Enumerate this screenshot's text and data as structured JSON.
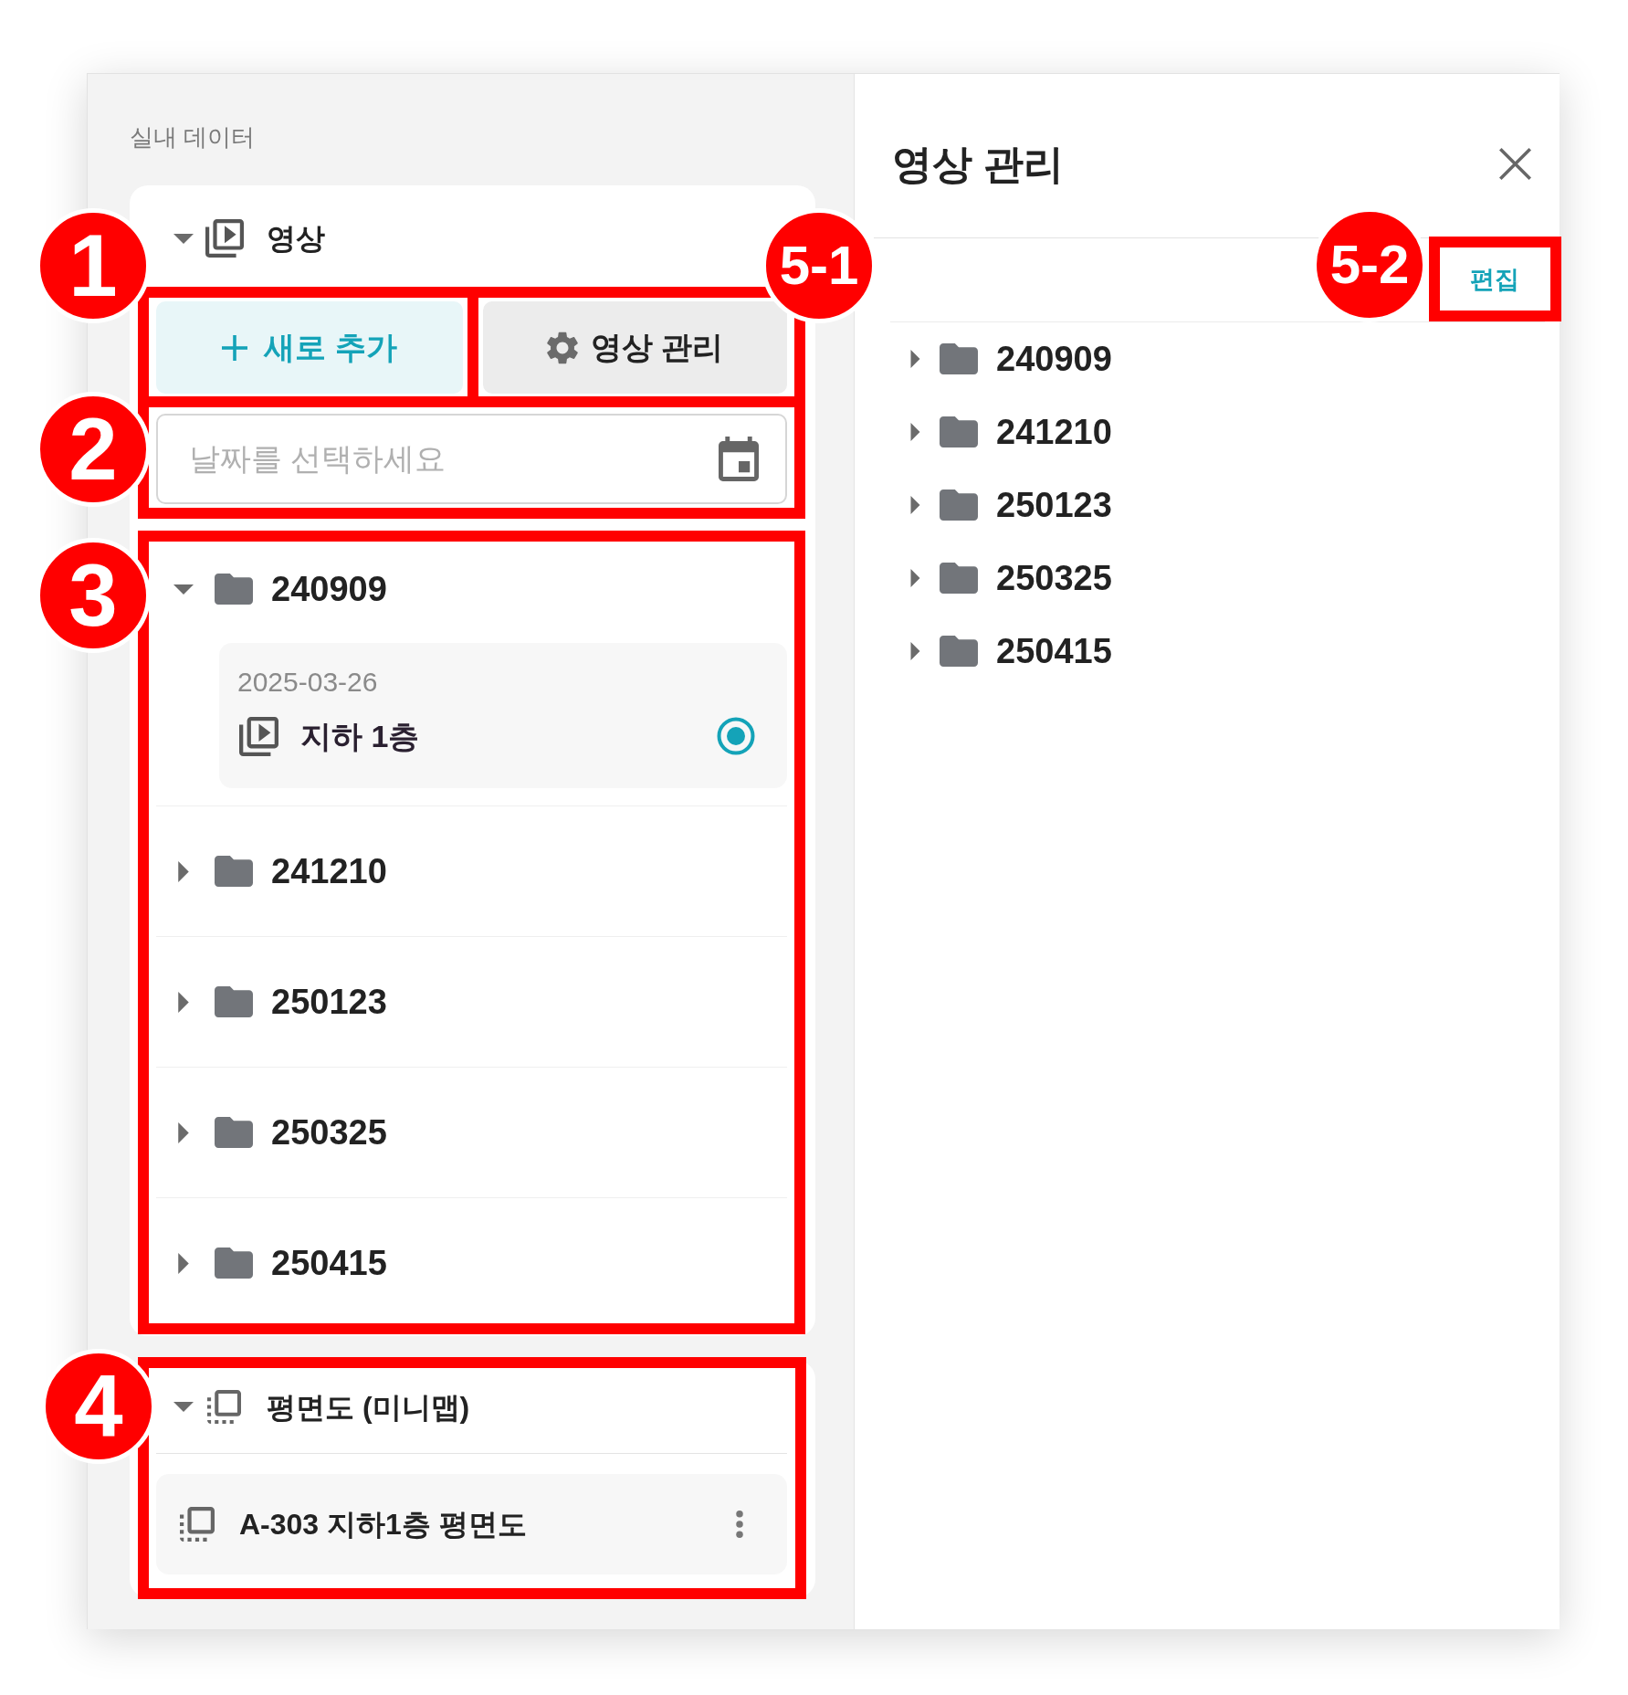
{
  "left_panel": {
    "heading": "실내 데이터",
    "video_section": {
      "title": "영상",
      "expanded": true,
      "buttons": [
        {
          "kind": "add",
          "label": "새로 추가",
          "callout": "1"
        },
        {
          "kind": "manage",
          "label": "영상 관리",
          "callout": "5-1"
        }
      ],
      "date_field": {
        "placeholder": "날짜를 선택하세요",
        "callout": "2"
      },
      "folder_list": {
        "callout": "3",
        "folders": [
          {
            "name": "240909",
            "expanded": true,
            "children": [
              {
                "date": "2025-03-26",
                "name": "지하 1층",
                "selected": true
              }
            ]
          },
          {
            "name": "241210",
            "expanded": false
          },
          {
            "name": "250123",
            "expanded": false
          },
          {
            "name": "250325",
            "expanded": false
          },
          {
            "name": "250415",
            "expanded": false
          }
        ]
      }
    },
    "floor_plan_section": {
      "title": "평면도 (미니맵)",
      "expanded": true,
      "callout": "4",
      "items": [
        {
          "name": "A-303 지하1층 평면도"
        }
      ]
    }
  },
  "right_panel": {
    "title": "영상 관리",
    "edit_button": {
      "label": "편집",
      "callout": "5-2"
    },
    "folders": [
      {
        "name": "240909",
        "expanded": false
      },
      {
        "name": "241210",
        "expanded": false
      },
      {
        "name": "250123",
        "expanded": false
      },
      {
        "name": "250325",
        "expanded": false
      },
      {
        "name": "250415",
        "expanded": false
      }
    ]
  }
}
